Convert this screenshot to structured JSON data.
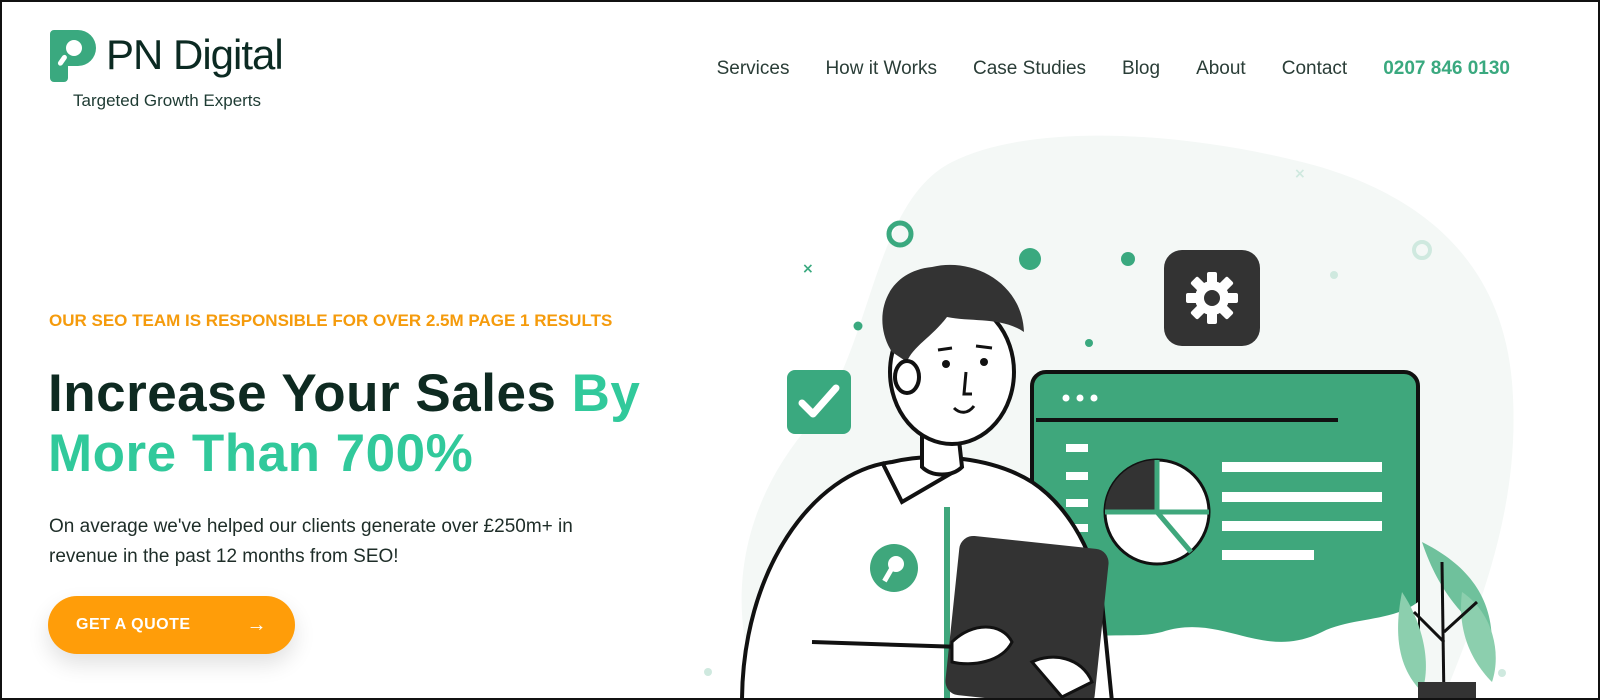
{
  "header": {
    "logo_text": "PN Digital",
    "tagline": "Targeted Growth Experts",
    "nav": [
      {
        "label": "Services"
      },
      {
        "label": "How it Works"
      },
      {
        "label": "Case Studies"
      },
      {
        "label": "Blog"
      },
      {
        "label": "About"
      },
      {
        "label": "Contact"
      }
    ],
    "phone": "0207 846 0130"
  },
  "hero": {
    "eyebrow": "OUR SEO TEAM IS RESPONSIBLE FOR OVER 2.5M PAGE 1 RESULTS",
    "headline_part1": "Increase Your Sales ",
    "headline_accent1": "By",
    "headline_accent2": "More Than 700%",
    "subtext": "On average we've helped our clients generate over £250m+ in revenue in the past 12 months from SEO!",
    "cta_label": "GET A QUOTE",
    "cta_icon": "arrow-right-icon"
  },
  "colors": {
    "brand_green": "#3aa97f",
    "accent_green": "#31c99b",
    "orange": "#ff9d09",
    "dark": "#0e2a21"
  }
}
